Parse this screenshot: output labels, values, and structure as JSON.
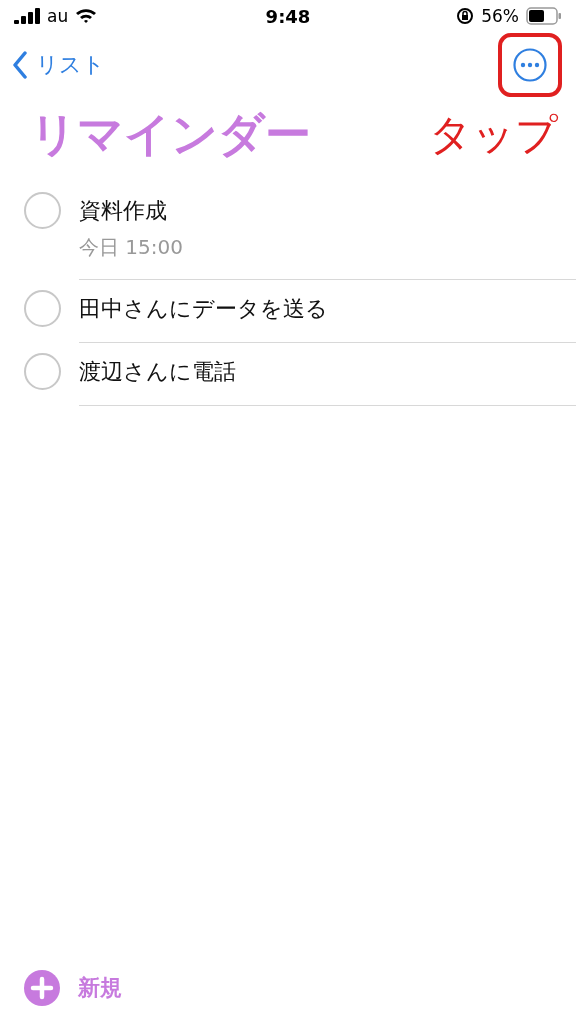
{
  "status_bar": {
    "carrier": "au",
    "time": "9:48",
    "battery": "56%"
  },
  "nav": {
    "back_label": "リスト",
    "more_button": {
      "highlighted": true
    }
  },
  "title": "リマインダー",
  "annotation": "タップ",
  "reminders": [
    {
      "title": "資料作成",
      "due": "今日 15:00",
      "checked": false
    },
    {
      "title": "田中さんにデータを送る",
      "checked": false
    },
    {
      "title": "渡辺さんに電話",
      "checked": false
    }
  ],
  "footer": {
    "new_label": "新規"
  }
}
